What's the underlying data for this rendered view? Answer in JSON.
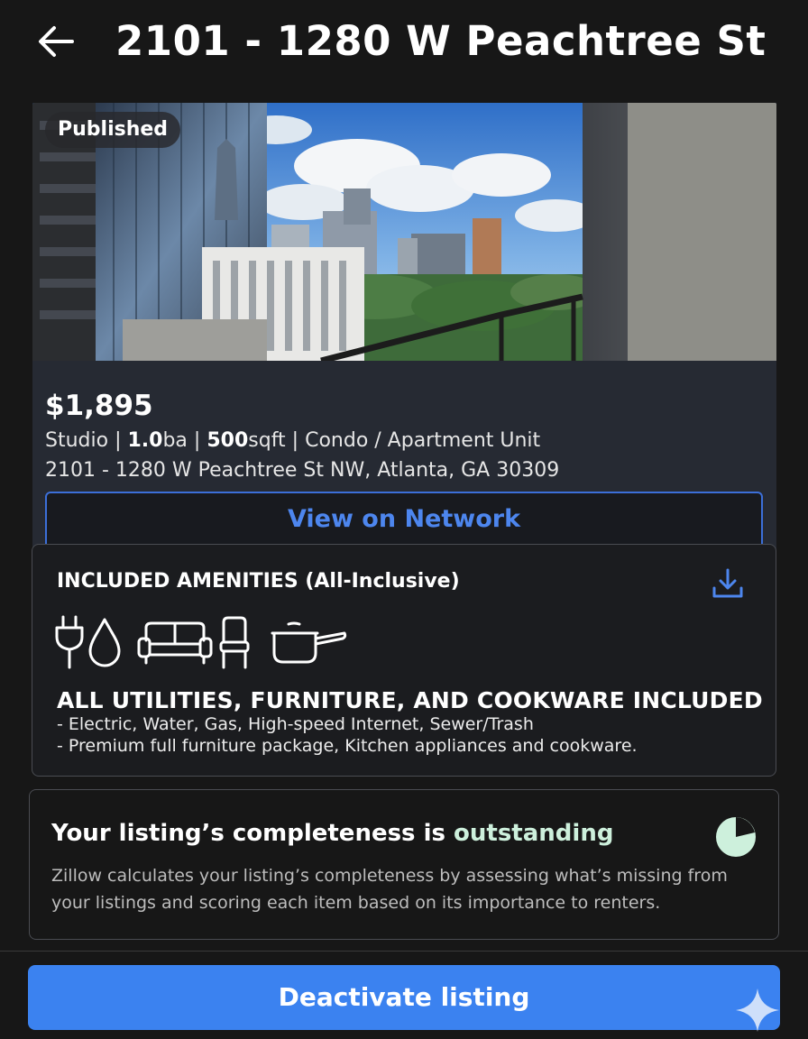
{
  "header": {
    "title": "2101 - 1280 W Peachtree St ...",
    "back_icon": "arrow-left-icon"
  },
  "listing": {
    "status_badge": "Published",
    "price": "$1,895",
    "facts": {
      "beds": "Studio",
      "sep1": " | ",
      "baths_value": "1.0",
      "baths_unit": "ba",
      "sep2": " | ",
      "sqft_value": "500",
      "sqft_unit": "sqft",
      "sep3": " | ",
      "type": "Condo / Apartment Unit"
    },
    "address": "2101 - 1280 W Peachtree St NW, Atlanta, GA 30309",
    "view_button": "View on Network"
  },
  "amenities": {
    "title": "INCLUDED AMENITIES (All-Inclusive)",
    "icons": [
      "plug-icon",
      "water-drop-icon",
      "sofa-icon",
      "chair-icon",
      "saucepan-icon"
    ],
    "download_icon": "download-icon",
    "headline": "ALL UTILITIES, FURNITURE, AND COOKWARE INCLUDED",
    "lines": [
      "- Electric, Water, Gas, High-speed Internet, Sewer/Trash",
      "- Premium full furniture package, Kitchen appliances and cookware."
    ]
  },
  "completeness": {
    "title_prefix": "Your listing’s completeness is ",
    "title_accent": "outstanding",
    "description": "Zillow calculates your listing’s completeness by assessing what’s missing from your listings and scoring each item based on its importance to renters.",
    "icon": "pie-progress-icon"
  },
  "footer": {
    "deactivate_button": "Deactivate listing",
    "sparkle_icon": "sparkle-icon"
  },
  "colors": {
    "accent_blue": "#3b82f0",
    "link_blue": "#4d86ee",
    "success_mint": "#cdf0dc",
    "background": "#171717",
    "card": "#262a33"
  }
}
